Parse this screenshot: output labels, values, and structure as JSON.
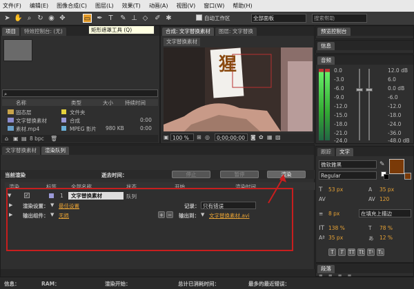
{
  "menu": [
    "文件(F)",
    "编辑(E)",
    "图像合成(C)",
    "图层(L)",
    "效果(T)",
    "动画(A)",
    "视图(V)",
    "窗口(W)",
    "帮助(H)"
  ],
  "toolbar": {
    "auto_open": "自动工作区",
    "workspace": "全部面板",
    "search_placeholder": "搜索帮助",
    "tooltip": "矩形遮罩工具 (Q)"
  },
  "project": {
    "tabs": [
      "项目",
      "特效控制台: (无)"
    ],
    "columns": [
      "名称",
      "类型",
      "大小",
      "持续时间"
    ],
    "items": [
      {
        "name": "固态层",
        "type": "文件夹",
        "size": "",
        "duration": ""
      },
      {
        "name": "文字替换素材",
        "type": "合成",
        "size": "",
        "duration": "0:00"
      },
      {
        "name": "素材.mp4",
        "type": "MPEG 影片",
        "size": "980 KB",
        "duration": "0:00"
      }
    ],
    "bpc": "8 bpc"
  },
  "comp": {
    "tabs": [
      "合成: 文字替换素材",
      "图层: 文字替换"
    ],
    "subtab": "文字替换素材",
    "sign_char": "猩",
    "zoom": "100 %",
    "timecode": "0;00;00;00"
  },
  "preview": {
    "title": "预览控制台"
  },
  "info": {
    "title": "信息"
  },
  "audio": {
    "title": "音频",
    "db_left": [
      "0.0",
      "-3.0",
      "-6.0",
      "-9.0",
      "-12.0",
      "-15.0",
      "-18.0",
      "-21.0",
      "-24.0"
    ],
    "db_right": [
      "12.0 dB",
      "6.0",
      "0.0 dB",
      "-6.0",
      "-12.0",
      "-18.0",
      "-24.0",
      "-36.0",
      "-48.0 dB"
    ]
  },
  "character": {
    "tabs": [
      "跟踪",
      "文字"
    ],
    "font": "微软雅黑",
    "style": "Regular",
    "size": "53 px",
    "leading": "35 px",
    "kerning": "",
    "tracking": "120",
    "stroke_width": "8 px",
    "stroke_mode": "在填充上描边",
    "v_scale": "138 %",
    "h_scale": "78 %",
    "baseline": "35 px",
    "tsume": "12 %",
    "color_fill": "#7a3a08"
  },
  "paragraph": {
    "title": "段落"
  },
  "render": {
    "tabs": [
      "文字替换素材",
      "渲染队列"
    ],
    "current": "当前渲染",
    "elapsed": "逝去时间：",
    "btn_stop": "停止",
    "btn_pause": "暂停",
    "btn_render": "渲染",
    "columns": [
      "渲染",
      "标签",
      "全部名称",
      "状态",
      "开始",
      "渲染时间"
    ],
    "item": {
      "num": "1",
      "name": "文字替换素材",
      "status": "队列"
    },
    "render_settings_label": "渲染设置：",
    "render_settings_value": "最佳设置",
    "log_label": "记录：",
    "log_value": "只有错误",
    "output_module_label": "输出组件：",
    "output_module_value": "无损",
    "output_to_label": "输出到：",
    "output_to_value": "文字替换素材.avi"
  },
  "status": {
    "message": "信息：",
    "ram": "RAM：",
    "renders_started": "渲染开始：",
    "total_time": "总计已消耗时间：",
    "recent_error": "最多的最近错误："
  }
}
